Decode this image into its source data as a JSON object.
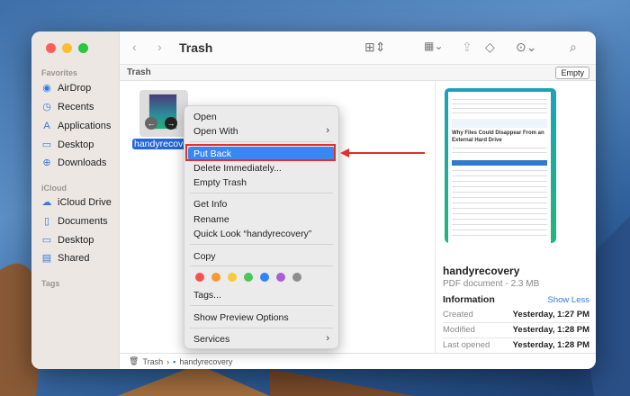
{
  "window": {
    "title": "Trash",
    "path_label": "Trash",
    "empty_button": "Empty"
  },
  "traffic_lights": {
    "close": "#fe5f57",
    "minimize": "#febc2e",
    "zoom": "#28c840"
  },
  "sidebar": {
    "favorites_label": "Favorites",
    "favorites": [
      {
        "label": "AirDrop",
        "icon": "airdrop-icon"
      },
      {
        "label": "Recents",
        "icon": "clock-icon"
      },
      {
        "label": "Applications",
        "icon": "applications-icon"
      },
      {
        "label": "Desktop",
        "icon": "desktop-icon"
      },
      {
        "label": "Downloads",
        "icon": "download-icon"
      }
    ],
    "icloud_label": "iCloud",
    "icloud": [
      {
        "label": "iCloud Drive",
        "icon": "cloud-icon"
      },
      {
        "label": "Documents",
        "icon": "document-icon"
      },
      {
        "label": "Desktop",
        "icon": "desktop-icon"
      },
      {
        "label": "Shared",
        "icon": "shared-folder-icon"
      }
    ],
    "tags_label": "Tags"
  },
  "file": {
    "name": "handyrecovery",
    "kind_size": "PDF document - 2.3 MB"
  },
  "context_menu": {
    "items": [
      "Open",
      "Open With",
      "Put Back",
      "Delete Immediately...",
      "Empty Trash",
      "Get Info",
      "Rename",
      "Quick Look “handyrecovery”",
      "Copy",
      "Tags...",
      "Show Preview Options",
      "Services"
    ],
    "highlighted": "Put Back",
    "tag_colors": [
      "#f5514b",
      "#f79a2e",
      "#f9c936",
      "#4cc65a",
      "#2f85f5",
      "#a95ed6",
      "#8e8e8e"
    ]
  },
  "preview": {
    "doc_heading": "Why Files Could Disappear From an External Hard Drive",
    "info_label": "Information",
    "show_less": "Show Less",
    "info": [
      {
        "label": "Created",
        "value": "Yesterday, 1:27 PM"
      },
      {
        "label": "Modified",
        "value": "Yesterday, 1:28 PM"
      },
      {
        "label": "Last opened",
        "value": "Yesterday, 1:28 PM"
      }
    ]
  },
  "bottom_path": [
    "Trash",
    "handyrecovery"
  ],
  "annotation_color": "#e0302a"
}
